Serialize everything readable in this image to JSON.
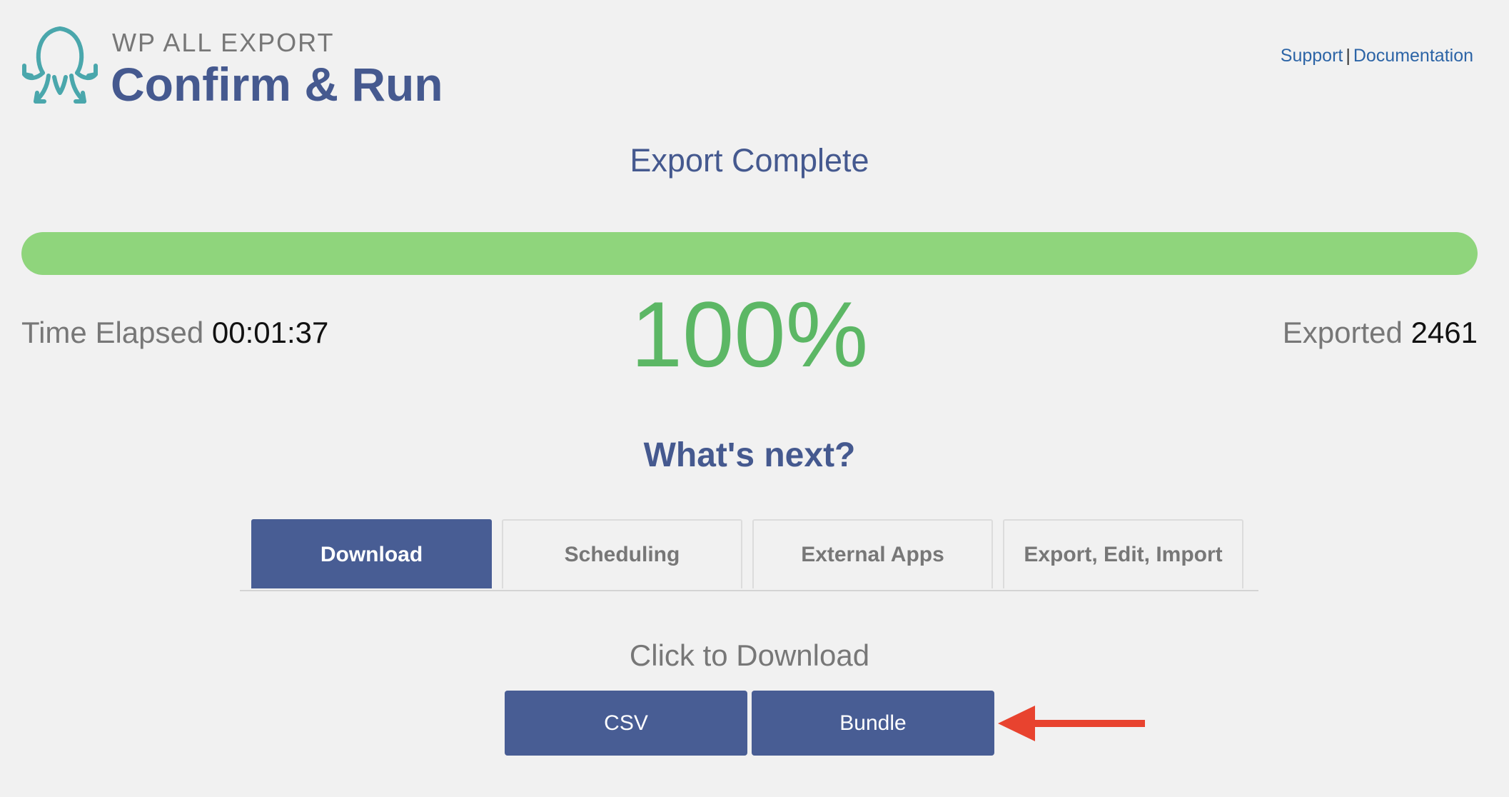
{
  "header": {
    "brand_small": "WP ALL EXPORT",
    "title": "Confirm & Run",
    "links": {
      "support": "Support",
      "separator": "|",
      "documentation": "Documentation"
    },
    "logo_icon": "octopus-logo-icon"
  },
  "status": {
    "heading": "Export Complete",
    "progress_percent": 100,
    "percent_label": "100%",
    "time_elapsed_label": "Time Elapsed",
    "time_elapsed_value": "00:01:37",
    "exported_label": "Exported",
    "exported_value": "2461"
  },
  "next": {
    "heading": "What's next?",
    "tabs": [
      {
        "label": "Download",
        "active": true
      },
      {
        "label": "Scheduling",
        "active": false
      },
      {
        "label": "External Apps",
        "active": false
      },
      {
        "label": "Export, Edit, Import",
        "active": false
      }
    ],
    "download_label": "Click to Download",
    "buttons": {
      "csv": "CSV",
      "bundle": "Bundle"
    },
    "annotation_icon": "arrow-left-icon"
  },
  "colors": {
    "accent": "#45598f",
    "button": "#485d94",
    "progress": "#8fd57c",
    "percent": "#5cb765",
    "link": "#2c64a6",
    "annotation_arrow": "#e8432f"
  }
}
